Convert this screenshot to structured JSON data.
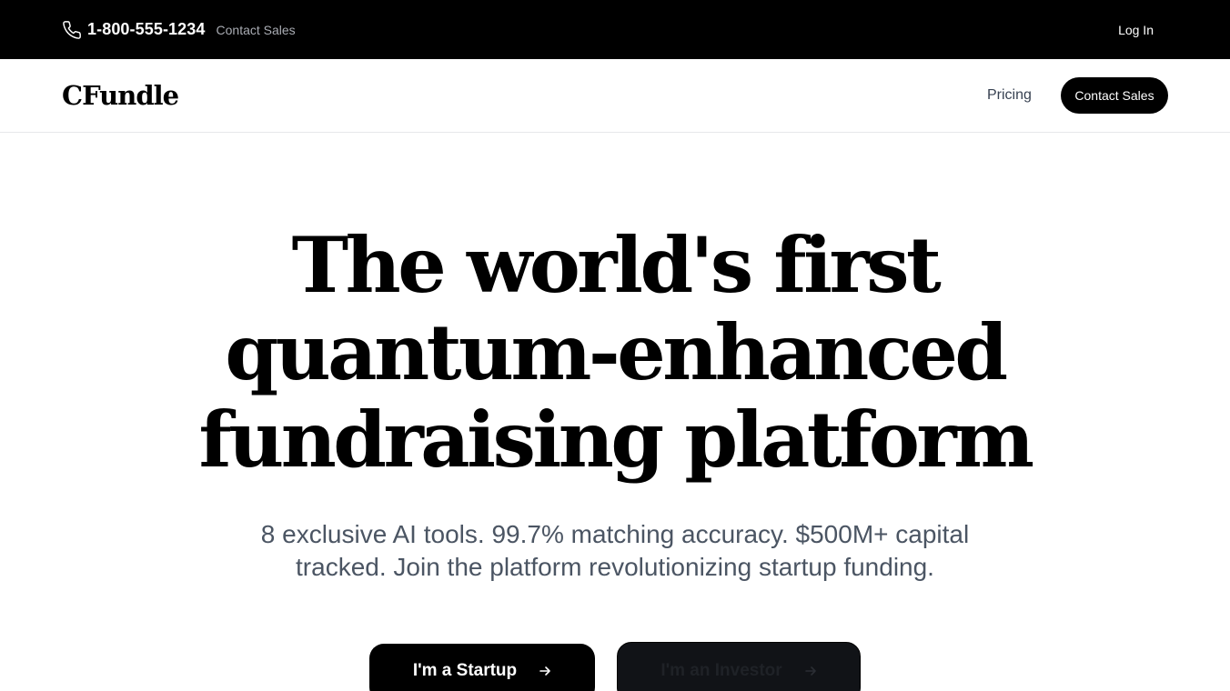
{
  "topbar": {
    "phone_icon": "phone-icon",
    "phone_number": "1-800-555-1234",
    "contact_sales": "Contact Sales",
    "login": "Log In"
  },
  "navbar": {
    "logo": "CFundle",
    "pricing": "Pricing",
    "contact_sales": "Contact Sales"
  },
  "hero": {
    "title_lines": [
      "The world's first",
      "quantum-enhanced",
      "fundraising platform"
    ],
    "subtitle_line1": "8 exclusive AI tools. 99.7% matching accuracy. $500M+ capital",
    "subtitle_line2": "tracked. Join the platform revolutionizing startup funding.",
    "cta_startup": "I'm a Startup",
    "cta_investor": "I'm an Investor",
    "arrow_icon": "arrow-right-icon"
  },
  "colors": {
    "topbar_bg": "#000000",
    "primary_button": "#000000",
    "subtitle_text": "#4b5563",
    "muted_link": "#a9acb3"
  }
}
